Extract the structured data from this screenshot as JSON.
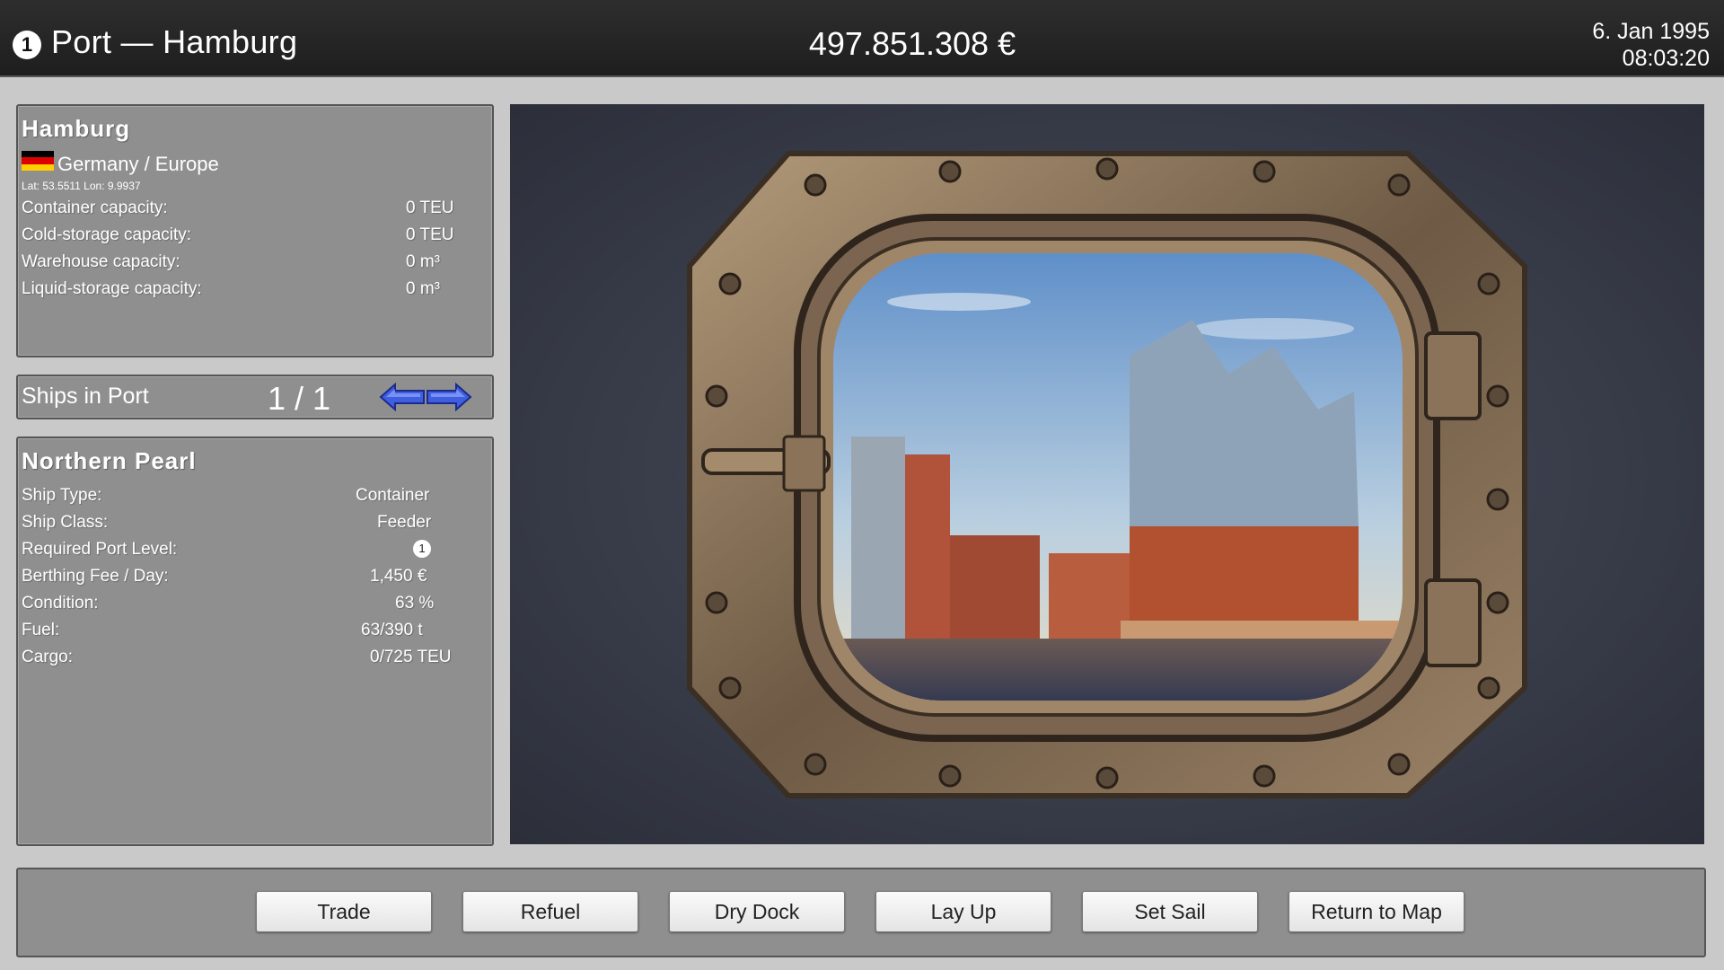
{
  "header": {
    "level": "1",
    "title": "Port — Hamburg",
    "money": "497.851.308 €",
    "date": "6. Jan 1995",
    "time": "08:03:20"
  },
  "port": {
    "name": "Hamburg",
    "flag_colors": [
      "#000000",
      "#dd0000",
      "#ffce00"
    ],
    "country_region": "Germany / Europe",
    "coords": "Lat: 53.5511 Lon: 9.9937",
    "rows": [
      {
        "label": "Container capacity:",
        "value": "0 TEU"
      },
      {
        "label": "Cold-storage capacity:",
        "value": "0 TEU"
      },
      {
        "label": "Warehouse capacity:",
        "value": "0 m³"
      },
      {
        "label": "Liquid-storage capacity:",
        "value": "0 m³"
      }
    ]
  },
  "ships_in_port": {
    "label": "Ships in Port",
    "count": "1 / 1",
    "prev_icon": "arrow-left-icon",
    "next_icon": "arrow-right-icon"
  },
  "ship": {
    "name": "Northern Pearl",
    "rows": [
      {
        "label": "Ship Type:",
        "value": "Container"
      },
      {
        "label": "Ship Class:",
        "value": "Feeder"
      },
      {
        "label": "Required Port Level:",
        "value": "1"
      },
      {
        "label": "Berthing Fee / Day:",
        "value": "1,450 €"
      },
      {
        "label": "Condition:",
        "value": "63 %"
      },
      {
        "label": "Fuel:",
        "value": "63/390 t"
      },
      {
        "label": "Cargo:",
        "value": "0/725 TEU"
      }
    ]
  },
  "actions": [
    "Trade",
    "Refuel",
    "Dry Dock",
    "Lay Up",
    "Set Sail",
    "Return to Map"
  ],
  "colors": {
    "topbar": "#262626",
    "panel": "#8f8f8f",
    "accent_arrow": "#3f5fe0"
  }
}
